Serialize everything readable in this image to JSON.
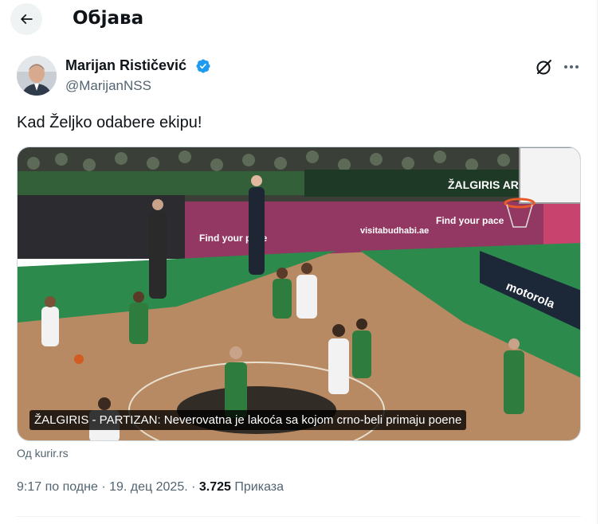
{
  "header": {
    "title": "Објава",
    "back_icon": "arrow-left-icon"
  },
  "author": {
    "name": "Marijan Rističević",
    "handle": "@MarijanNSS",
    "verified": true,
    "verified_color": "#1d9bf0"
  },
  "actions": {
    "grok_icon": "grok-icon",
    "more_icon": "more-horizontal-icon"
  },
  "tweet": {
    "text": "Kad Željko odabere ekipu!"
  },
  "media": {
    "type": "video-card",
    "scene_text": {
      "ad_left": "Find your pace",
      "ad_center": "visitabudhabi.ae",
      "ad_right": "Find your pace",
      "sponsor": "motorola",
      "arena": "ŽALGIRIS ARENA"
    },
    "caption": "ŽALGIRIS - PARTIZAN: Neverovatna je lakoća sa kojom crno-beli primaju poene"
  },
  "source": "Од kurir.rs",
  "meta": {
    "time": "9:17 по подне",
    "sep1": " · ",
    "date": "19. дец 2025.",
    "sep2": " · ",
    "views_count": "3.725",
    "views_label": " Приказа"
  },
  "colors": {
    "text_primary": "#0f1419",
    "text_secondary": "#536471",
    "border": "#eff3f4"
  }
}
